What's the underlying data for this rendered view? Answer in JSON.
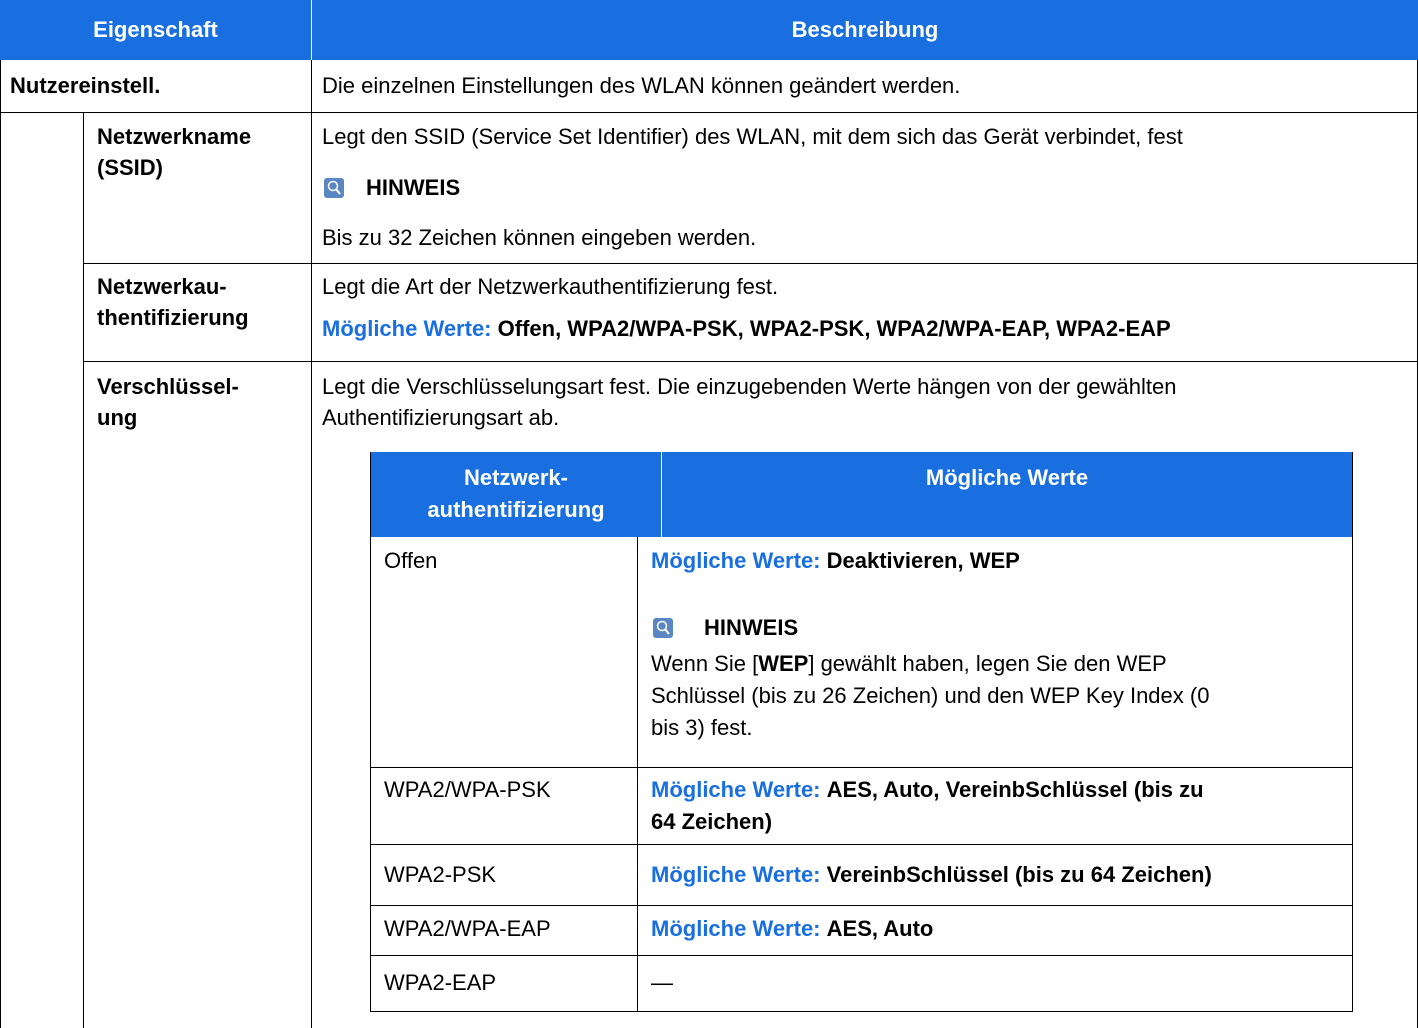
{
  "header": {
    "col1": "Eigenschaft",
    "col2": "Beschreibung"
  },
  "rows": {
    "nutzer": {
      "name": "Nutzereinstell.",
      "desc": "Die einzelnen Einstellungen des WLAN können geändert werden."
    },
    "ssid": {
      "name_line1": "Netzwerkname",
      "name_line2": "(SSID)",
      "desc": "Legt den SSID (Service Set Identifier) des WLAN, mit dem sich das Gerät verbindet, fest",
      "note_title": "HINWEIS",
      "note_text": "Bis zu 32 Zeichen können eingeben werden."
    },
    "auth": {
      "name_line1": "Netzwerkau-",
      "name_line2": "thentifizierung",
      "desc": "Legt die Art der Netzwerkauthentifizierung fest.",
      "values_label": "Mögliche Werte:",
      "values": "Offen, WPA2/WPA-PSK, WPA2-PSK, WPA2/WPA-EAP, WPA2-EAP"
    },
    "enc": {
      "name_line1": "Verschlüssel-",
      "name_line2": "ung",
      "desc_line1": "Legt die Verschlüsselungsart fest. Die einzugebenden Werte hängen von der gewählten",
      "desc_line2": "Authentifizierungsart ab."
    }
  },
  "subtable": {
    "header": {
      "col1_line1": "Netzwerk-",
      "col1_line2": "authentifizierung",
      "col2": "Mögliche Werte"
    },
    "rows": [
      {
        "auth": "Offen",
        "values_label": "Mögliche Werte:",
        "values": "Deaktivieren, WEP",
        "note_title": "HINWEIS",
        "note_pre": "Wenn Sie [",
        "note_bold": "WEP",
        "note_post": "] gewählt haben, legen Sie den WEP",
        "note_line2": "Schlüssel (bis zu 26 Zeichen) und den WEP Key Index (0",
        "note_line3": "bis 3) fest."
      },
      {
        "auth": "WPA2/WPA-PSK",
        "values_label": "Mögliche Werte:",
        "values_line1": "AES, Auto, VereinbSchlüssel (bis zu",
        "values_line2": "64 Zeichen)"
      },
      {
        "auth": "WPA2-PSK",
        "values_label": "Mögliche Werte:",
        "values": "VereinbSchlüssel (bis zu 64 Zeichen)"
      },
      {
        "auth": "WPA2/WPA-EAP",
        "values_label": "Mögliche Werte:",
        "values": "AES, Auto"
      },
      {
        "auth": "WPA2-EAP",
        "values": "—"
      }
    ]
  }
}
